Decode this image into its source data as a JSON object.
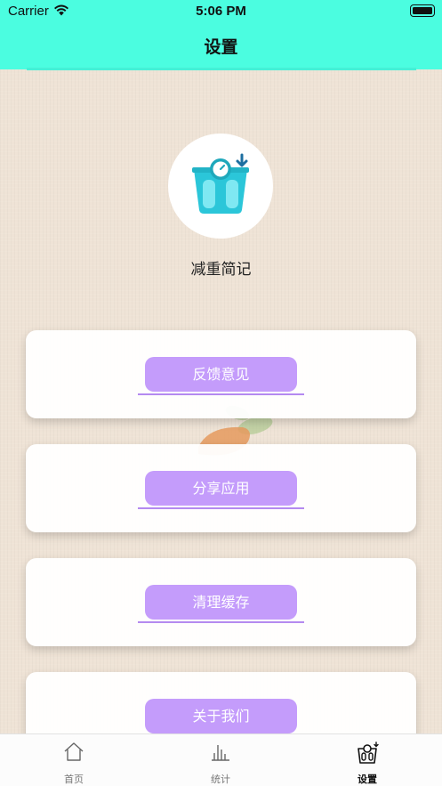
{
  "status_bar": {
    "carrier": "Carrier",
    "time": "5:06 PM"
  },
  "header": {
    "title": "设置"
  },
  "app": {
    "name": "减重简记"
  },
  "menu": [
    {
      "label": "反馈意见"
    },
    {
      "label": "分享应用"
    },
    {
      "label": "清理缓存"
    },
    {
      "label": "关于我们"
    }
  ],
  "tabbar": [
    {
      "label": "首页",
      "icon": "home-icon"
    },
    {
      "label": "统计",
      "icon": "chart-icon"
    },
    {
      "label": "设置",
      "icon": "scale-icon",
      "active": true
    }
  ],
  "colors": {
    "header": "#4bfde0",
    "accent": "#c49cfb",
    "background": "#efe3d6"
  }
}
